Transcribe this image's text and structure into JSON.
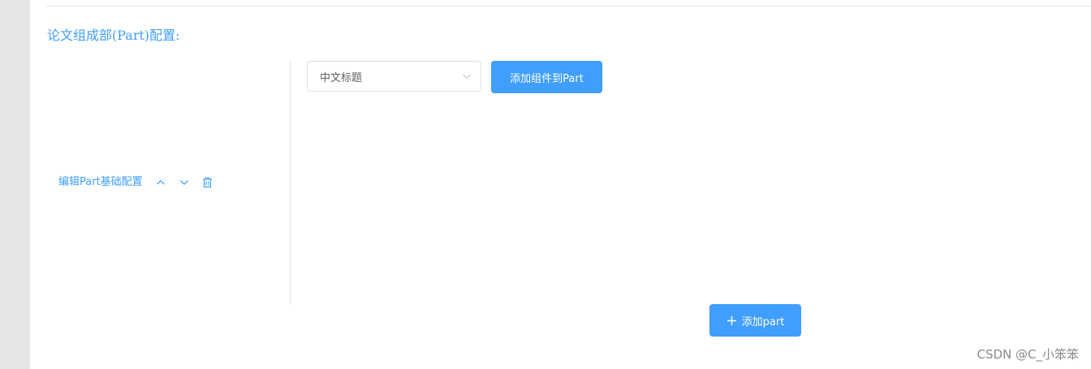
{
  "section": {
    "title": "论文组成部(Part)配置:"
  },
  "part": {
    "edit_link": "编辑Part基础配置",
    "move_up_icon": "chevron-up-icon",
    "move_down_icon": "chevron-down-icon",
    "delete_icon": "trash-icon"
  },
  "component_select": {
    "value": "中文标题",
    "arrow_icon": "chevron-down-icon"
  },
  "buttons": {
    "add_component": "添加组件到Part",
    "add_part": "添加part",
    "add_part_icon": "plus-icon"
  },
  "watermark": "CSDN @C_小笨笨",
  "colors": {
    "accent": "#409eff",
    "gutter": "#e5e5e5",
    "border": "#dcdfe6",
    "text_regular": "#606266",
    "watermark": "#8a8a8a"
  }
}
